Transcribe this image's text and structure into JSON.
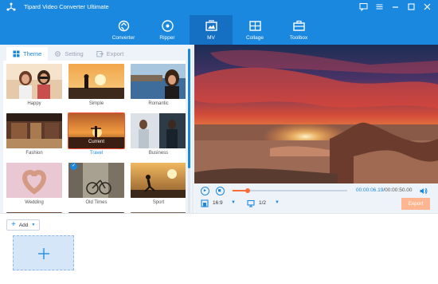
{
  "app": {
    "title": "Tipard Video Converter Ultimate"
  },
  "window_controls": [
    "chat-icon",
    "menu-icon",
    "minimize-icon",
    "maximize-icon",
    "close-icon"
  ],
  "nav": [
    {
      "label": "Converter",
      "icon": "converter-icon",
      "active": false
    },
    {
      "label": "Ripper",
      "icon": "ripper-icon",
      "active": false
    },
    {
      "label": "MV",
      "icon": "mv-icon",
      "active": true
    },
    {
      "label": "Collage",
      "icon": "collage-icon",
      "active": false
    },
    {
      "label": "Toolbox",
      "icon": "toolbox-icon",
      "active": false
    }
  ],
  "tabs": [
    {
      "label": "Theme",
      "active": true
    },
    {
      "label": "Setting",
      "active": false
    },
    {
      "label": "Export",
      "active": false
    }
  ],
  "themes": [
    {
      "name": "Happy",
      "selected": false
    },
    {
      "name": "Simple",
      "selected": false
    },
    {
      "name": "Romantic",
      "selected": false
    },
    {
      "name": "Fashion",
      "selected": false
    },
    {
      "name": "Travel",
      "selected": true,
      "badge": "Current"
    },
    {
      "name": "Business",
      "selected": false
    },
    {
      "name": "Wedding",
      "selected": false
    },
    {
      "name": "Old Times",
      "selected": false
    },
    {
      "name": "Sport",
      "selected": false
    }
  ],
  "player": {
    "time_current": "00:00:06.19",
    "time_total": "/00:00:50.00",
    "progress": 0.13,
    "aspect_ratio": "16:9",
    "screen": "1/2",
    "export_label": "Export"
  },
  "bottom": {
    "add_label": "Add"
  },
  "colors": {
    "accent": "#1a88df",
    "active_nav": "#156fc2",
    "selection": "#ff4d38",
    "export_disabled": "#ffb690"
  }
}
